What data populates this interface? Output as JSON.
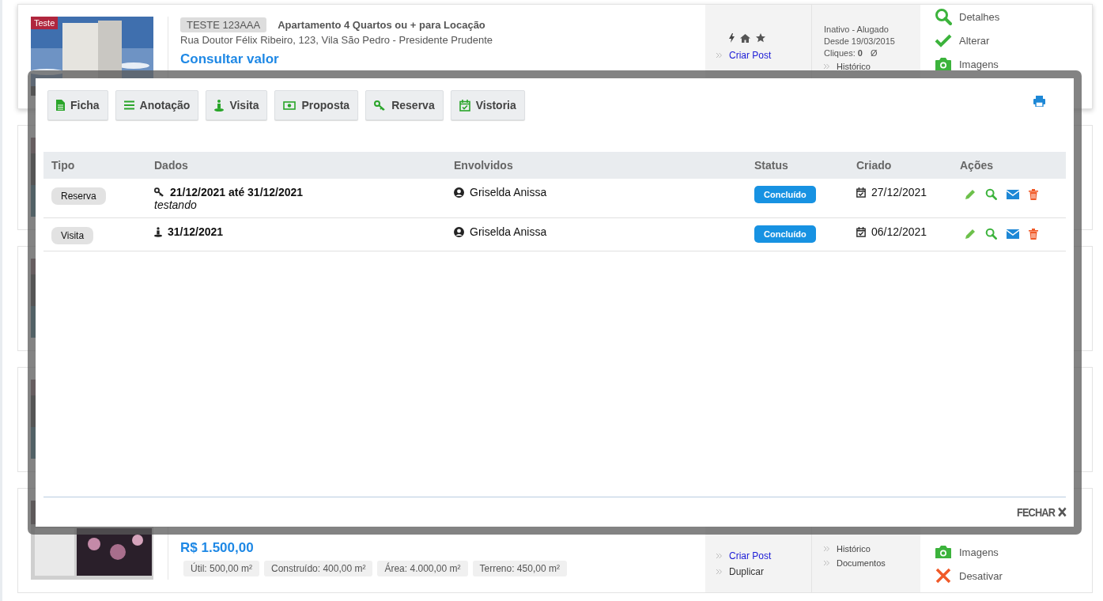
{
  "listings": [
    {
      "kind": "full",
      "badge": "Teste",
      "code": "TESTE 123AAA",
      "title": "Apartamento 4 Quartos ou + para Locação",
      "address": "Rua Doutor Félix Ribeiro, 123, Vila São Pedro - Presidente Prudente",
      "price": "Consultar valor",
      "links": [
        {
          "label": "Criar Post",
          "kind": "primary"
        }
      ],
      "status_lines": [
        "Inativo - Alugado",
        "Desde 19/03/2015"
      ],
      "clicks": {
        "label": "Cliques:",
        "value": "0",
        "mark": "Ø"
      },
      "status_links": [
        "Histórico"
      ],
      "actions": [
        {
          "kind": "details",
          "label": "Detalhes"
        },
        {
          "kind": "edit",
          "label": "Alterar"
        },
        {
          "kind": "images",
          "label": "Imagens"
        }
      ]
    },
    {
      "kind": "covered"
    },
    {
      "kind": "covered"
    },
    {
      "kind": "covered"
    },
    {
      "kind": "bottom",
      "price": "R$ 1.500,00",
      "tags": [
        "Útil: 500,00 m²",
        "Construído: 400,00 m²",
        "Área: 4.000,00 m²",
        "Terreno: 450,00 m²"
      ],
      "links": [
        {
          "label": "Criar Post",
          "kind": "primary"
        },
        {
          "label": "Duplicar",
          "kind": "plain"
        }
      ],
      "status_links": [
        "Histórico",
        "Documentos"
      ],
      "actions": [
        {
          "kind": "images",
          "label": "Imagens"
        },
        {
          "kind": "deactivate",
          "label": "Desativar"
        }
      ]
    }
  ],
  "modal": {
    "toolbar": [
      {
        "kind": "file",
        "label": "Ficha"
      },
      {
        "kind": "list",
        "label": "Anotação"
      },
      {
        "kind": "visit",
        "label": "Visita"
      },
      {
        "kind": "money",
        "label": "Proposta"
      },
      {
        "kind": "key",
        "label": "Reserva"
      },
      {
        "kind": "calendar",
        "label": "Vistoria"
      }
    ],
    "columns": [
      "Tipo",
      "Dados",
      "Envolvidos",
      "Status",
      "Criado",
      "Ações"
    ],
    "rows": [
      {
        "type": "Reserva",
        "kind": "key",
        "dates": "21/12/2021 até 31/12/2021",
        "note": "testando",
        "person": "Griselda Anissa",
        "status": "Concluído",
        "created": "27/12/2021"
      },
      {
        "type": "Visita",
        "kind": "visit",
        "dates": "31/12/2021",
        "person": "Griselda Anissa",
        "status": "Concluído",
        "created": "06/12/2021"
      }
    ],
    "close": "FECHAR"
  }
}
